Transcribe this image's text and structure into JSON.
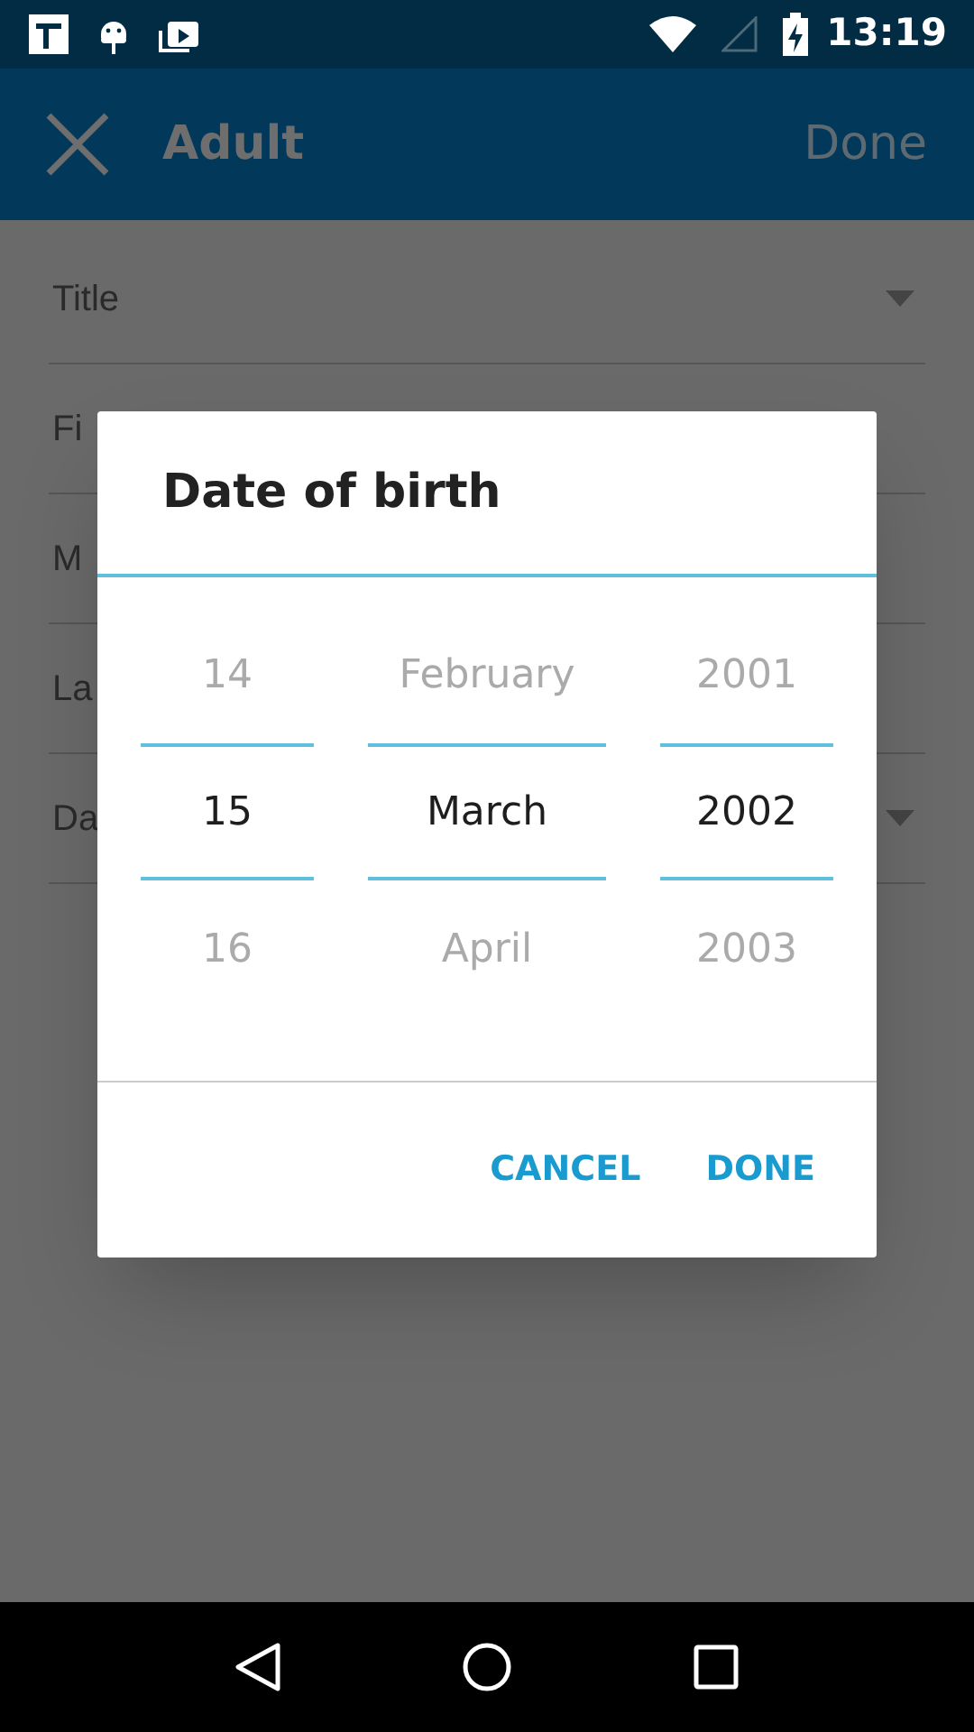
{
  "status_bar": {
    "time": "13:19"
  },
  "app_bar": {
    "title": "Adult",
    "action": "Done"
  },
  "form": {
    "fields": [
      {
        "label": "Title",
        "dropdown": true
      },
      {
        "label": "Fi",
        "dropdown": false
      },
      {
        "label": "M",
        "dropdown": false
      },
      {
        "label": "La",
        "dropdown": false
      },
      {
        "label": "Da",
        "dropdown": true
      }
    ]
  },
  "dialog": {
    "title": "Date of birth",
    "columns": [
      {
        "items": [
          {
            "label": "14",
            "selected": false
          },
          {
            "label": "15",
            "selected": true
          },
          {
            "label": "16",
            "selected": false
          }
        ]
      },
      {
        "items": [
          {
            "label": "February",
            "selected": false
          },
          {
            "label": "March",
            "selected": true
          },
          {
            "label": "April",
            "selected": false
          }
        ]
      },
      {
        "items": [
          {
            "label": "2001",
            "selected": false
          },
          {
            "label": "2002",
            "selected": true
          },
          {
            "label": "2003",
            "selected": false
          }
        ]
      }
    ],
    "buttons": [
      "CANCEL",
      "DONE"
    ]
  }
}
